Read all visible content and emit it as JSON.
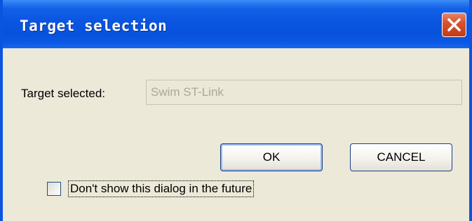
{
  "window": {
    "title": "Target selection"
  },
  "form": {
    "target_label": "Target selected:",
    "target_value": "Swim ST-Link"
  },
  "buttons": {
    "ok_label": "OK",
    "cancel_label": "CANCEL"
  },
  "options": {
    "dont_show_label": "Don't show this dialog in the future",
    "dont_show_checked": false
  },
  "icons": {
    "close": "close-icon"
  },
  "colors": {
    "titlebar": "#0a55e0",
    "window_bg": "#ece9d8",
    "close_button": "#d9532f",
    "disabled_text": "#aca899"
  }
}
